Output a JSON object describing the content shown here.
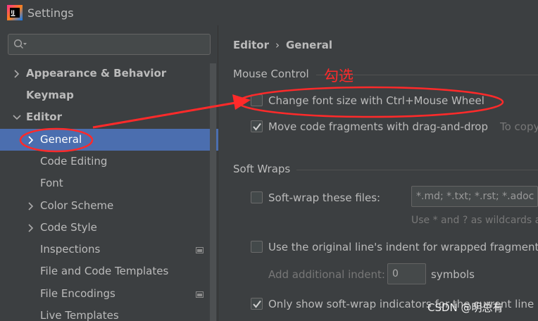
{
  "window": {
    "title": "Settings"
  },
  "sidebar": {
    "search_placeholder": "",
    "items": [
      {
        "label": "Appearance & Behavior",
        "expandable": true,
        "expanded": false,
        "bold": true
      },
      {
        "label": "Keymap",
        "expandable": false,
        "bold": true
      },
      {
        "label": "Editor",
        "expandable": true,
        "expanded": true,
        "bold": true
      },
      {
        "label": "General",
        "expandable": true,
        "expanded": false,
        "selected": true
      },
      {
        "label": "Code Editing",
        "expandable": false
      },
      {
        "label": "Font",
        "expandable": false
      },
      {
        "label": "Color Scheme",
        "expandable": true,
        "expanded": false
      },
      {
        "label": "Code Style",
        "expandable": true,
        "expanded": false
      },
      {
        "label": "Inspections",
        "expandable": false,
        "page_marker": true
      },
      {
        "label": "File and Code Templates",
        "expandable": false
      },
      {
        "label": "File Encodings",
        "expandable": false,
        "page_marker": true
      },
      {
        "label": "Live Templates",
        "expandable": false
      }
    ]
  },
  "breadcrumb": {
    "parent": "Editor",
    "separator": "›",
    "current": "General"
  },
  "mouse_control": {
    "title": "Mouse Control",
    "change_font_size": {
      "label": "Change font size with Ctrl+Mouse Wheel",
      "checked": false
    },
    "move_fragments": {
      "label": "Move code fragments with drag-and-drop",
      "checked": true,
      "hint": "To copy"
    }
  },
  "soft_wraps": {
    "title": "Soft Wraps",
    "soft_wrap_files": {
      "label": "Soft-wrap these files:",
      "checked": false,
      "value": "*.md; *.txt; *.rst; *.adoc",
      "hint": "Use * and ? as wildcards a"
    },
    "original_indent": {
      "label": "Use the original line's indent for wrapped fragments",
      "checked": false
    },
    "additional_indent": {
      "label": "Add additional indent:",
      "value": "0",
      "suffix": "symbols"
    },
    "only_show_indicators": {
      "label": "Only show soft-wrap indicators for the current line",
      "checked": true
    }
  },
  "annotation": {
    "text": "勾选"
  },
  "watermark": {
    "text": "CSDN @明总有"
  },
  "colors": {
    "selection": "#4b6eaf",
    "annotation": "#ff2a2a",
    "background": "#3c3f41"
  }
}
